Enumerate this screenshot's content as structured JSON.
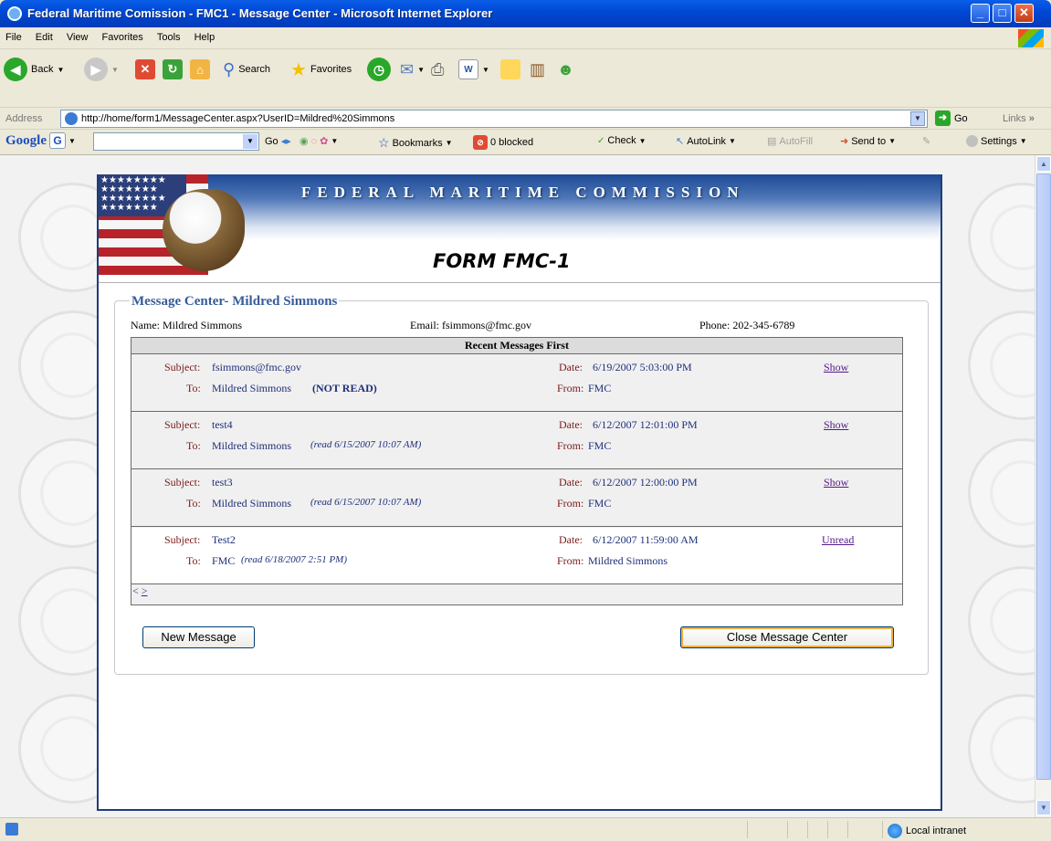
{
  "window": {
    "title": "Federal Maritime Comission - FMC1 - Message Center - Microsoft Internet Explorer"
  },
  "menu": [
    "File",
    "Edit",
    "View",
    "Favorites",
    "Tools",
    "Help"
  ],
  "toolbar": {
    "back": "Back",
    "search": "Search",
    "favorites": "Favorites"
  },
  "address": {
    "label": "Address",
    "url": "http://home/form1/MessageCenter.aspx?UserID=Mildred%20Simmons",
    "go": "Go",
    "links": "Links"
  },
  "googlebar": {
    "logo": "Google",
    "go": "Go",
    "bookmarks": "Bookmarks",
    "blocked": "0 blocked",
    "check": "Check",
    "autolink": "AutoLink",
    "autofill": "AutoFill",
    "sendto": "Send to",
    "settings": "Settings"
  },
  "banner": {
    "agency": "FEDERAL MARITIME COMMISSION",
    "form_title": "FORM FMC-1"
  },
  "message_center": {
    "title": "Message Center- Mildred Simmons",
    "name": "Name: Mildred Simmons",
    "email": "Email: fsimmons@fmc.gov",
    "phone": "Phone: 202-345-6789",
    "table_header": "Recent Messages First",
    "messages": [
      {
        "subject_label": "Subject:",
        "subject": "fsimmons@fmc.gov",
        "date_label": "Date:",
        "date": "6/19/2007 5:03:00 PM",
        "action": "Show",
        "to_label": "To:",
        "to": "Mildred Simmons",
        "status": "(NOT READ)",
        "from_label": "From:",
        "from": "FMC"
      },
      {
        "subject_label": "Subject:",
        "subject": "test4",
        "date_label": "Date:",
        "date": "6/12/2007 12:01:00 PM",
        "action": "Show",
        "to_label": "To:",
        "to": "Mildred Simmons",
        "status": "(read 6/15/2007 10:07 AM)",
        "from_label": "From:",
        "from": "FMC"
      },
      {
        "subject_label": "Subject:",
        "subject": "test3",
        "date_label": "Date:",
        "date": "6/12/2007 12:00:00 PM",
        "action": "Show",
        "to_label": "To:",
        "to": "Mildred Simmons",
        "status": "(read 6/15/2007 10:07 AM)",
        "from_label": "From:",
        "from": "FMC"
      },
      {
        "subject_label": "Subject:",
        "subject": "Test2",
        "date_label": "Date:",
        "date": "6/12/2007 11:59:00 AM",
        "action": "Unread",
        "to_label": "To:",
        "to": "FMC",
        "status": "(read 6/18/2007 2:51 PM)",
        "from_label": "From:",
        "from": "Mildred Simmons"
      }
    ],
    "pager_prev": "<",
    "pager_next": ">",
    "new_message": "New Message",
    "close": "Close Message Center"
  },
  "status": {
    "zone": "Local intranet"
  },
  "colors": {
    "accent": "#365c9a",
    "label_red": "#7a1a1a",
    "value_blue": "#1f2f7a",
    "visited_link": "#551a8b"
  }
}
